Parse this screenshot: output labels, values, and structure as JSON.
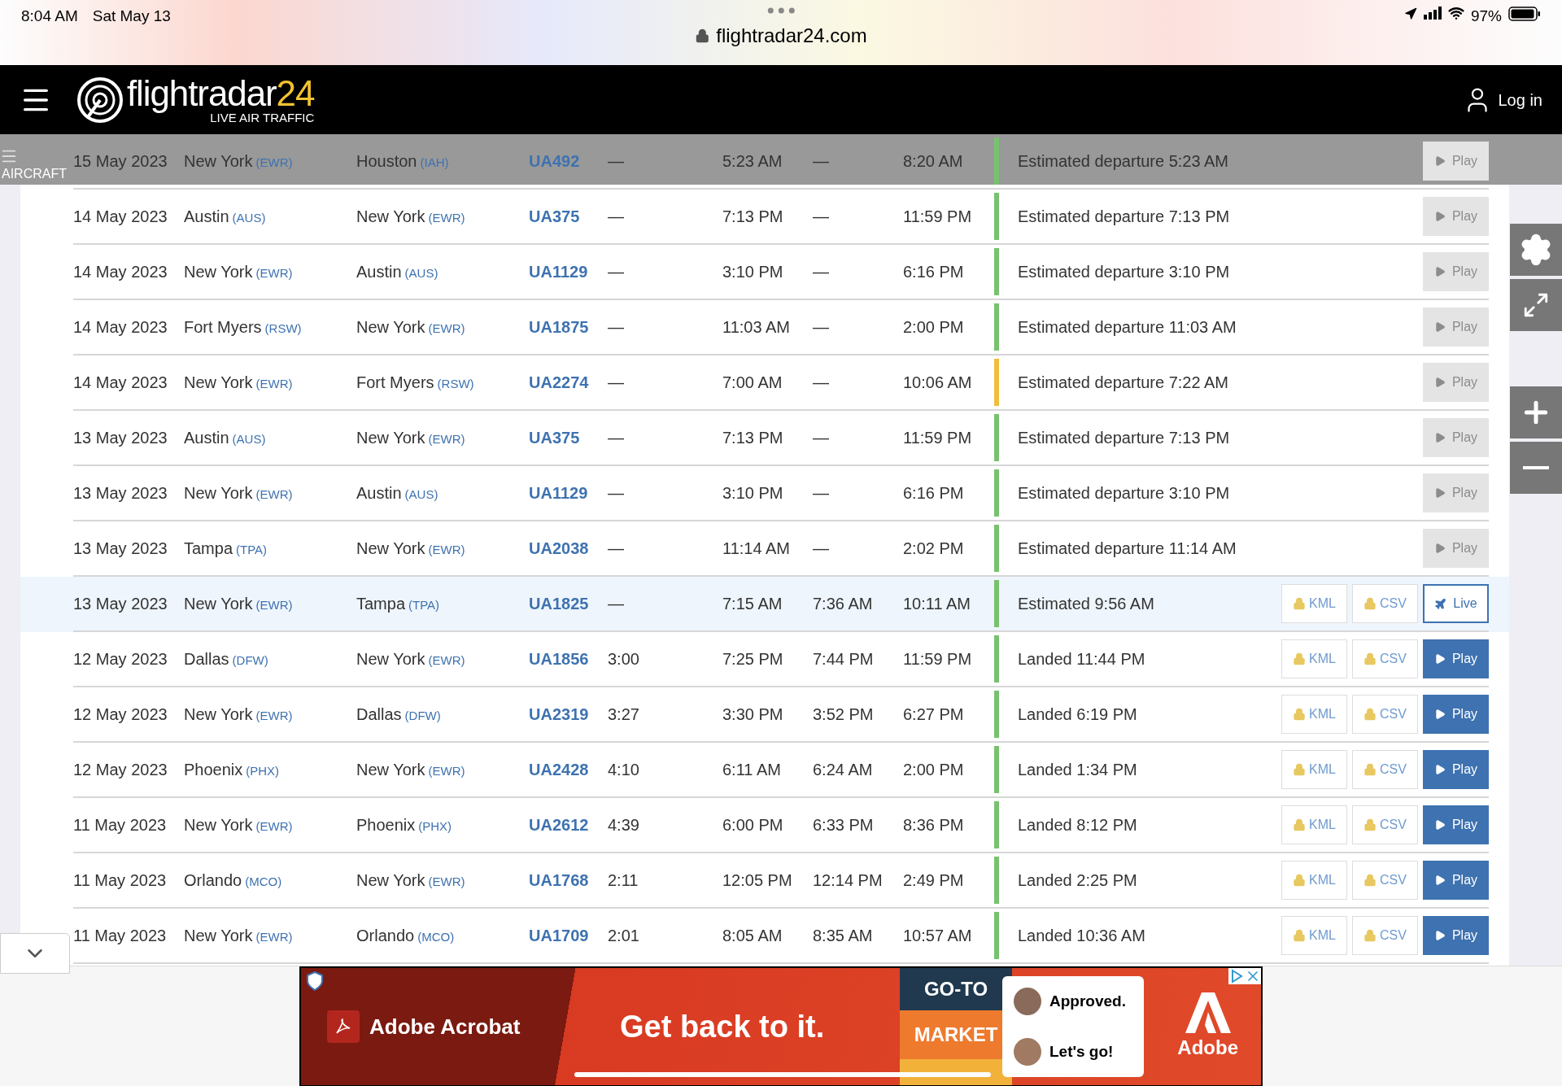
{
  "status_bar": {
    "time": "8:04 AM",
    "date": "Sat May 13",
    "url": "flightradar24.com",
    "battery": "97%"
  },
  "header": {
    "logo_main": "flightradar",
    "logo_num": "24",
    "tagline": "LIVE AIR TRAFFIC",
    "login": "Log in"
  },
  "side_tab": {
    "label": "AIRCRAFT"
  },
  "rows": [
    {
      "date": "15 May 2023",
      "from": "New York",
      "from_code": "(EWR)",
      "to": "Houston",
      "to_code": "(IAH)",
      "flight": "UA492",
      "duration": "—",
      "std": "5:23 AM",
      "atd": "—",
      "sta": "8:20 AM",
      "color": "#78c26f",
      "status": "Estimated departure 5:23 AM",
      "selected": false,
      "action": {
        "kind": "play",
        "label": "Play",
        "disabled": true
      }
    },
    {
      "date": "14 May 2023",
      "from": "Austin",
      "from_code": "(AUS)",
      "to": "New York",
      "to_code": "(EWR)",
      "flight": "UA375",
      "duration": "—",
      "std": "7:13 PM",
      "atd": "—",
      "sta": "11:59 PM",
      "color": "#78c26f",
      "status": "Estimated departure 7:13 PM",
      "selected": false,
      "action": {
        "kind": "play",
        "label": "Play",
        "disabled": true
      }
    },
    {
      "date": "14 May 2023",
      "from": "New York",
      "from_code": "(EWR)",
      "to": "Austin",
      "to_code": "(AUS)",
      "flight": "UA1129",
      "duration": "—",
      "std": "3:10 PM",
      "atd": "—",
      "sta": "6:16 PM",
      "color": "#78c26f",
      "status": "Estimated departure 3:10 PM",
      "selected": false,
      "action": {
        "kind": "play",
        "label": "Play",
        "disabled": true
      }
    },
    {
      "date": "14 May 2023",
      "from": "Fort Myers",
      "from_code": "(RSW)",
      "to": "New York",
      "to_code": "(EWR)",
      "flight": "UA1875",
      "duration": "—",
      "std": "11:03 AM",
      "atd": "—",
      "sta": "2:00 PM",
      "color": "#78c26f",
      "status": "Estimated departure 11:03 AM",
      "selected": false,
      "action": {
        "kind": "play",
        "label": "Play",
        "disabled": true
      }
    },
    {
      "date": "14 May 2023",
      "from": "New York",
      "from_code": "(EWR)",
      "to": "Fort Myers",
      "to_code": "(RSW)",
      "flight": "UA2274",
      "duration": "—",
      "std": "7:00 AM",
      "atd": "—",
      "sta": "10:06 AM",
      "color": "#f0be3c",
      "status": "Estimated departure 7:22 AM",
      "selected": false,
      "action": {
        "kind": "play",
        "label": "Play",
        "disabled": true
      }
    },
    {
      "date": "13 May 2023",
      "from": "Austin",
      "from_code": "(AUS)",
      "to": "New York",
      "to_code": "(EWR)",
      "flight": "UA375",
      "duration": "—",
      "std": "7:13 PM",
      "atd": "—",
      "sta": "11:59 PM",
      "color": "#78c26f",
      "status": "Estimated departure 7:13 PM",
      "selected": false,
      "action": {
        "kind": "play",
        "label": "Play",
        "disabled": true
      }
    },
    {
      "date": "13 May 2023",
      "from": "New York",
      "from_code": "(EWR)",
      "to": "Austin",
      "to_code": "(AUS)",
      "flight": "UA1129",
      "duration": "—",
      "std": "3:10 PM",
      "atd": "—",
      "sta": "6:16 PM",
      "color": "#78c26f",
      "status": "Estimated departure 3:10 PM",
      "selected": false,
      "action": {
        "kind": "play",
        "label": "Play",
        "disabled": true
      }
    },
    {
      "date": "13 May 2023",
      "from": "Tampa",
      "from_code": "(TPA)",
      "to": "New York",
      "to_code": "(EWR)",
      "flight": "UA2038",
      "duration": "—",
      "std": "11:14 AM",
      "atd": "—",
      "sta": "2:02 PM",
      "color": "#78c26f",
      "status": "Estimated departure 11:14 AM",
      "selected": false,
      "action": {
        "kind": "play",
        "label": "Play",
        "disabled": true
      }
    },
    {
      "date": "13 May 2023",
      "from": "New York",
      "from_code": "(EWR)",
      "to": "Tampa",
      "to_code": "(TPA)",
      "flight": "UA1825",
      "duration": "—",
      "std": "7:15 AM",
      "atd": "7:36 AM",
      "sta": "10:11 AM",
      "color": "#78c26f",
      "status": "Estimated 9:56 AM",
      "selected": true,
      "downloads": [
        "KML",
        "CSV"
      ],
      "action": {
        "kind": "live",
        "label": "Live",
        "disabled": false
      }
    },
    {
      "date": "12 May 2023",
      "from": "Dallas",
      "from_code": "(DFW)",
      "to": "New York",
      "to_code": "(EWR)",
      "flight": "UA1856",
      "duration": "3:00",
      "std": "7:25 PM",
      "atd": "7:44 PM",
      "sta": "11:59 PM",
      "color": "#78c26f",
      "status": "Landed 11:44 PM",
      "selected": false,
      "downloads": [
        "KML",
        "CSV"
      ],
      "action": {
        "kind": "play",
        "label": "Play",
        "disabled": false
      }
    },
    {
      "date": "12 May 2023",
      "from": "New York",
      "from_code": "(EWR)",
      "to": "Dallas",
      "to_code": "(DFW)",
      "flight": "UA2319",
      "duration": "3:27",
      "std": "3:30 PM",
      "atd": "3:52 PM",
      "sta": "6:27 PM",
      "color": "#78c26f",
      "status": "Landed 6:19 PM",
      "selected": false,
      "downloads": [
        "KML",
        "CSV"
      ],
      "action": {
        "kind": "play",
        "label": "Play",
        "disabled": false
      }
    },
    {
      "date": "12 May 2023",
      "from": "Phoenix",
      "from_code": "(PHX)",
      "to": "New York",
      "to_code": "(EWR)",
      "flight": "UA2428",
      "duration": "4:10",
      "std": "6:11 AM",
      "atd": "6:24 AM",
      "sta": "2:00 PM",
      "color": "#78c26f",
      "status": "Landed 1:34 PM",
      "selected": false,
      "downloads": [
        "KML",
        "CSV"
      ],
      "action": {
        "kind": "play",
        "label": "Play",
        "disabled": false
      }
    },
    {
      "date": "11 May 2023",
      "from": "New York",
      "from_code": "(EWR)",
      "to": "Phoenix",
      "to_code": "(PHX)",
      "flight": "UA2612",
      "duration": "4:39",
      "std": "6:00 PM",
      "atd": "6:33 PM",
      "sta": "8:36 PM",
      "color": "#78c26f",
      "status": "Landed 8:12 PM",
      "selected": false,
      "downloads": [
        "KML",
        "CSV"
      ],
      "action": {
        "kind": "play",
        "label": "Play",
        "disabled": false
      }
    },
    {
      "date": "11 May 2023",
      "from": "Orlando",
      "from_code": "(MCO)",
      "to": "New York",
      "to_code": "(EWR)",
      "flight": "UA1768",
      "duration": "2:11",
      "std": "12:05 PM",
      "atd": "12:14 PM",
      "sta": "2:49 PM",
      "color": "#78c26f",
      "status": "Landed 2:25 PM",
      "selected": false,
      "downloads": [
        "KML",
        "CSV"
      ],
      "action": {
        "kind": "play",
        "label": "Play",
        "disabled": false
      }
    },
    {
      "date": "11 May 2023",
      "from": "New York",
      "from_code": "(EWR)",
      "to": "Orlando",
      "to_code": "(MCO)",
      "flight": "UA1709",
      "duration": "2:01",
      "std": "8:05 AM",
      "atd": "8:35 AM",
      "sta": "10:57 AM",
      "color": "#78c26f",
      "status": "Landed 10:36 AM",
      "selected": false,
      "downloads": [
        "KML",
        "CSV"
      ],
      "action": {
        "kind": "play",
        "label": "Play",
        "disabled": false
      }
    }
  ],
  "ad": {
    "brand": "Adobe Acrobat",
    "headline": "Get back to it.",
    "tile_top": "GO-TO",
    "tile_mid": "MARKET",
    "chat_1": "Approved.",
    "chat_2": "Let's go!",
    "logo": "Adobe"
  }
}
